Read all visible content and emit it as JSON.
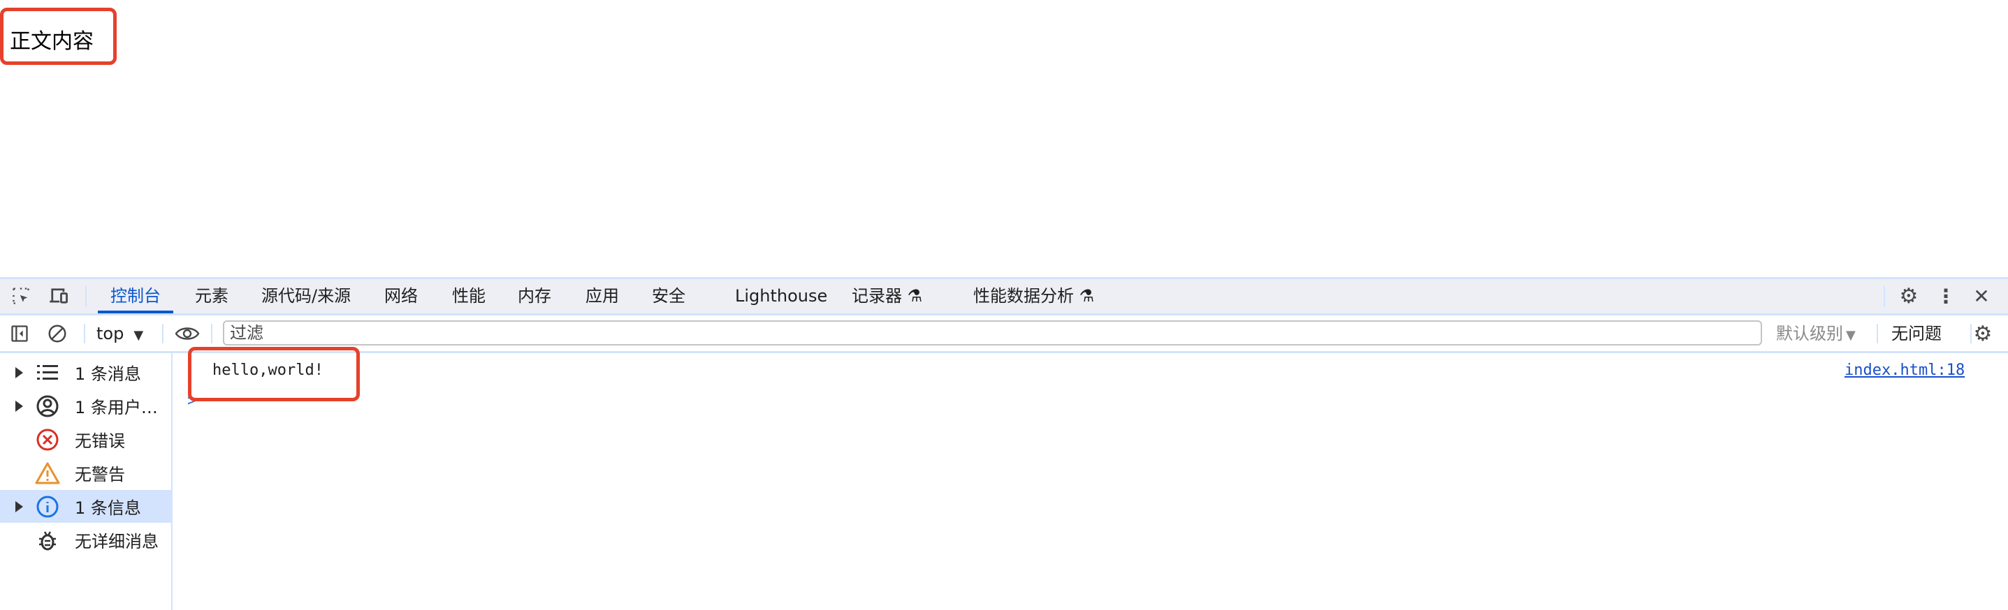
{
  "page": {
    "heading": "正文内容"
  },
  "devtools": {
    "tabs": [
      "控制台",
      "元素",
      "源代码/来源",
      "网络",
      "性能",
      "内存",
      "应用",
      "安全",
      "Lighthouse",
      "记录器",
      "性能数据分析"
    ],
    "active_tab": "控制台",
    "toolbar": {
      "context": "top",
      "filter_placeholder": "过滤",
      "level": "默认级别",
      "issues": "无问题"
    },
    "sidebar": [
      {
        "label": "1 条消息",
        "icon": "list-icon",
        "expandable": true
      },
      {
        "label": "1 条用户…",
        "icon": "user-icon",
        "expandable": true
      },
      {
        "label": "无错误",
        "icon": "error-icon",
        "expandable": false
      },
      {
        "label": "无警告",
        "icon": "warning-icon",
        "expandable": false
      },
      {
        "label": "1 条信息",
        "icon": "info-icon",
        "expandable": true,
        "selected": true
      },
      {
        "label": "无详细消息",
        "icon": "bug-icon",
        "expandable": false
      }
    ],
    "console": {
      "message": "hello,world!",
      "source": "index.html:18",
      "prompt": ">"
    },
    "colors": {
      "accent": "#0b57d0",
      "highlight": "#e5412b",
      "error": "#d93025",
      "warning": "#e8912d",
      "selected_bg": "#d3e3fd"
    }
  }
}
